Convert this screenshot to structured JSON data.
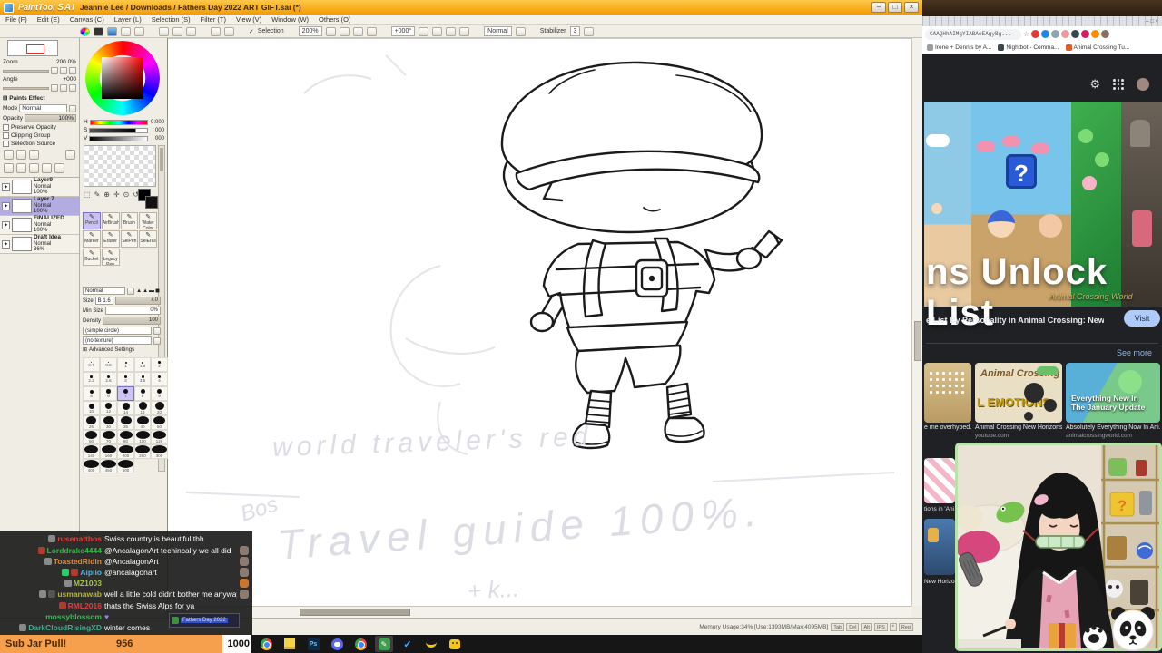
{
  "sai": {
    "logo_part1": "PaintTool",
    "logo_part2": "SAI",
    "title": "Jeannie Lee / Downloads / Fathers Day 2022 ART GIFT.sai (*)",
    "window_controls": [
      "–",
      "□",
      "×"
    ],
    "menus": [
      "File (F)",
      "Edit (E)",
      "Canvas (C)",
      "Layer (L)",
      "Selection (S)",
      "Filter (T)",
      "View (V)",
      "Window (W)",
      "Others (O)"
    ],
    "toolbar": {
      "selection_label": "Selection",
      "zoom_value": "200%",
      "angle_value": "+000°",
      "mode_value": "Normal",
      "stabilizer_label": "Stabilizer",
      "stabilizer_value": "3"
    },
    "navigator": {
      "zoom_label": "Zoom",
      "zoom_value": "200.0%",
      "angle_label": "Angle",
      "angle_value": "+000"
    },
    "paints_effect_label": "Paints Effect",
    "mode_label": "Mode",
    "mode_value": "Normal",
    "opacity_label": "Opacity",
    "opacity_value": "100%",
    "options": [
      {
        "label": "Preserve Opacity"
      },
      {
        "label": "Clipping Group"
      },
      {
        "label": "Selection Source"
      }
    ],
    "layers": [
      {
        "name": "Layer9",
        "mode": "Normal",
        "op": "100%"
      },
      {
        "name": "Layer 7",
        "mode": "Normal",
        "op": "100%",
        "selected": true
      },
      {
        "name": "FINALIZED",
        "mode": "Normal",
        "op": "100%"
      },
      {
        "name": "Draft Idea",
        "mode": "Normal",
        "op": "36%"
      }
    ],
    "hsv": {
      "h": "H",
      "h_val": "0:000",
      "s": "S",
      "s_val": "000",
      "v": "V",
      "v_val": "000"
    },
    "tools": [
      {
        "label": "Pencil",
        "selected": true
      },
      {
        "label": "AirBrush"
      },
      {
        "label": "Brush"
      },
      {
        "label": "Water Color"
      },
      {
        "label": "Marker"
      },
      {
        "label": "Eraser"
      },
      {
        "label": "SelPen"
      },
      {
        "label": "SelEras"
      },
      {
        "label": "Bucket"
      },
      {
        "label": "Legacy Pen"
      }
    ],
    "brush": {
      "mode": "Normal",
      "shapes": "▲▲▬◼",
      "size_label": "Size",
      "size_badge": "B 1.6",
      "size_value": "7.0",
      "minsize_label": "Min Size",
      "minsize_value": "0%",
      "density_label": "Density",
      "density_value": "100",
      "shape_option": "(simple circle)",
      "texture_option": "(no texture)",
      "advanced_label": "Advanced Settings"
    },
    "brush_sizes": [
      {
        "v": "0.7",
        "d": 1.5
      },
      {
        "v": "0.8",
        "d": 1.5
      },
      {
        "v": "1",
        "d": 2
      },
      {
        "v": "1.5",
        "d": 2
      },
      {
        "v": "2",
        "d": 2.5
      },
      {
        "v": "2.3",
        "d": 2.5
      },
      {
        "v": "2.6",
        "d": 3
      },
      {
        "v": "3",
        "d": 3
      },
      {
        "v": "3.5",
        "d": 3
      },
      {
        "v": "4",
        "d": 3.5
      },
      {
        "v": "5",
        "d": 4
      },
      {
        "v": "6",
        "d": 4.5
      },
      {
        "v": "7",
        "d": 5,
        "selected": true
      },
      {
        "v": "8",
        "d": 5
      },
      {
        "v": "9",
        "d": 5.5
      },
      {
        "v": "10",
        "d": 6
      },
      {
        "v": "12",
        "d": 7
      },
      {
        "v": "14",
        "d": 8
      },
      {
        "v": "16",
        "d": 9
      },
      {
        "v": "20",
        "d": 10
      },
      {
        "v": "25",
        "d": 11
      },
      {
        "v": "30",
        "d": 12
      },
      {
        "v": "35",
        "d": 12
      },
      {
        "v": "40",
        "d": 13
      },
      {
        "v": "50",
        "d": 13
      },
      {
        "v": "60",
        "d": 13
      },
      {
        "v": "70",
        "d": 14
      },
      {
        "v": "80",
        "d": 14
      },
      {
        "v": "100",
        "d": 15
      },
      {
        "v": "120",
        "d": 15
      },
      {
        "v": "140",
        "d": 15
      },
      {
        "v": "160",
        "d": 16
      },
      {
        "v": "200",
        "d": 16
      },
      {
        "v": "250",
        "d": 16
      },
      {
        "v": "300",
        "d": 17
      },
      {
        "v": "400",
        "d": 17
      },
      {
        "v": "450",
        "d": 17
      },
      {
        "v": "500",
        "d": 17
      }
    ],
    "status_text": "Memory Usage:34% [Use:1393MB/Max:4095MB]",
    "status_chips": [
      {
        "t": "Tab"
      },
      {
        "t": "Del"
      },
      {
        "t": "Alt"
      },
      {
        "t": "IPS"
      },
      {
        "t": "*"
      },
      {
        "t": "Reg"
      }
    ],
    "sketch": {
      "line1": "world traveler's red",
      "line2": "Bos",
      "line3": "Travel guide 100%.",
      "line4": "+ k..."
    }
  },
  "chat": {
    "messages": [
      {
        "b1": "#8a8a8a",
        "name": "rusenatthos",
        "color": "#e03e3e",
        "text": "Swiss country is beautiful tbh"
      },
      {
        "b1": "#b03a2e",
        "name": "Lorddrake4444",
        "color": "#33b54a",
        "text": "@AncalagonArt techincally we all did",
        "emote": "#8d7b6f"
      },
      {
        "b1": "#8a8a8a",
        "name": "ToastedRidin",
        "color": "#dd8a33",
        "text": "@AncalagonArt",
        "emote": "#8d7b6f"
      },
      {
        "b1": "#2ecc71",
        "b2": "#b03a2e",
        "name": "Aiplio",
        "color": "#4fb6e0",
        "text": "@ancalagonart",
        "emote": "#8d7b6f"
      },
      {
        "b1": "#8a8a8a",
        "name": "MZ1003",
        "color": "#a6c34c",
        "text": "",
        "emote": "#c8762e"
      },
      {
        "b1": "#8a8a8a",
        "b2": "#555555",
        "name": "usmanawab",
        "color": "#b5b33e",
        "text": "well a little cold didnt bother me anyways",
        "emote": "#8d7b6f"
      },
      {
        "b1": "#b03a2e",
        "name": "RML2016",
        "color": "#e03e3e",
        "text": "thats the Swiss Alps for ya"
      },
      {
        "name": "mossyblossom",
        "color": "#3dbb57",
        "text": "♥",
        "tcolor": "#9a7fe8"
      },
      {
        "b1": "#8a8a8a",
        "name": "DarkCloudRisingXD",
        "color": "#35b28a",
        "text": "winter comes"
      }
    ]
  },
  "tooltip": {
    "text": "Fathers Day 2022"
  },
  "subjar": {
    "label": "Sub Jar Pull!",
    "current": "956",
    "goal": "1000"
  },
  "browser": {
    "tab_controls": "–  □  ×",
    "url": "CAAQHhAIMgYIABAeEAgyBg...",
    "bookmarks": [
      {
        "label": "Irene + Dennis by A...",
        "c": "#9e9e9e"
      },
      {
        "label": "Nightbot - Comma...",
        "c": "#37474f"
      },
      {
        "label": "Animal Crossing Tu...",
        "c": "#e05a2b"
      }
    ],
    "hero_title": "ns Unlock List",
    "watermark": "Animal Crossing World",
    "caption": "e List By Personality in Animal Crossing: New Horizons",
    "visit_label": "Visit",
    "see_more": "See more",
    "thumbs": [
      {
        "title": "e me overhyped...",
        "src": ""
      },
      {
        "title": "Animal Crossing New Horizons ...",
        "src": "youtube.com"
      },
      {
        "title": "Absolutely Everything Now In Ani...",
        "src": "animalcrossingworld.com"
      }
    ],
    "thumb2_line1": "Animal Crossing",
    "thumb2_line2": "L EMOTIONS",
    "thumb3_line1": "Everything New In",
    "thumb3_line2": "The January Update",
    "fragments": [
      "tions in 'Ani",
      "New Horizo..."
    ]
  }
}
